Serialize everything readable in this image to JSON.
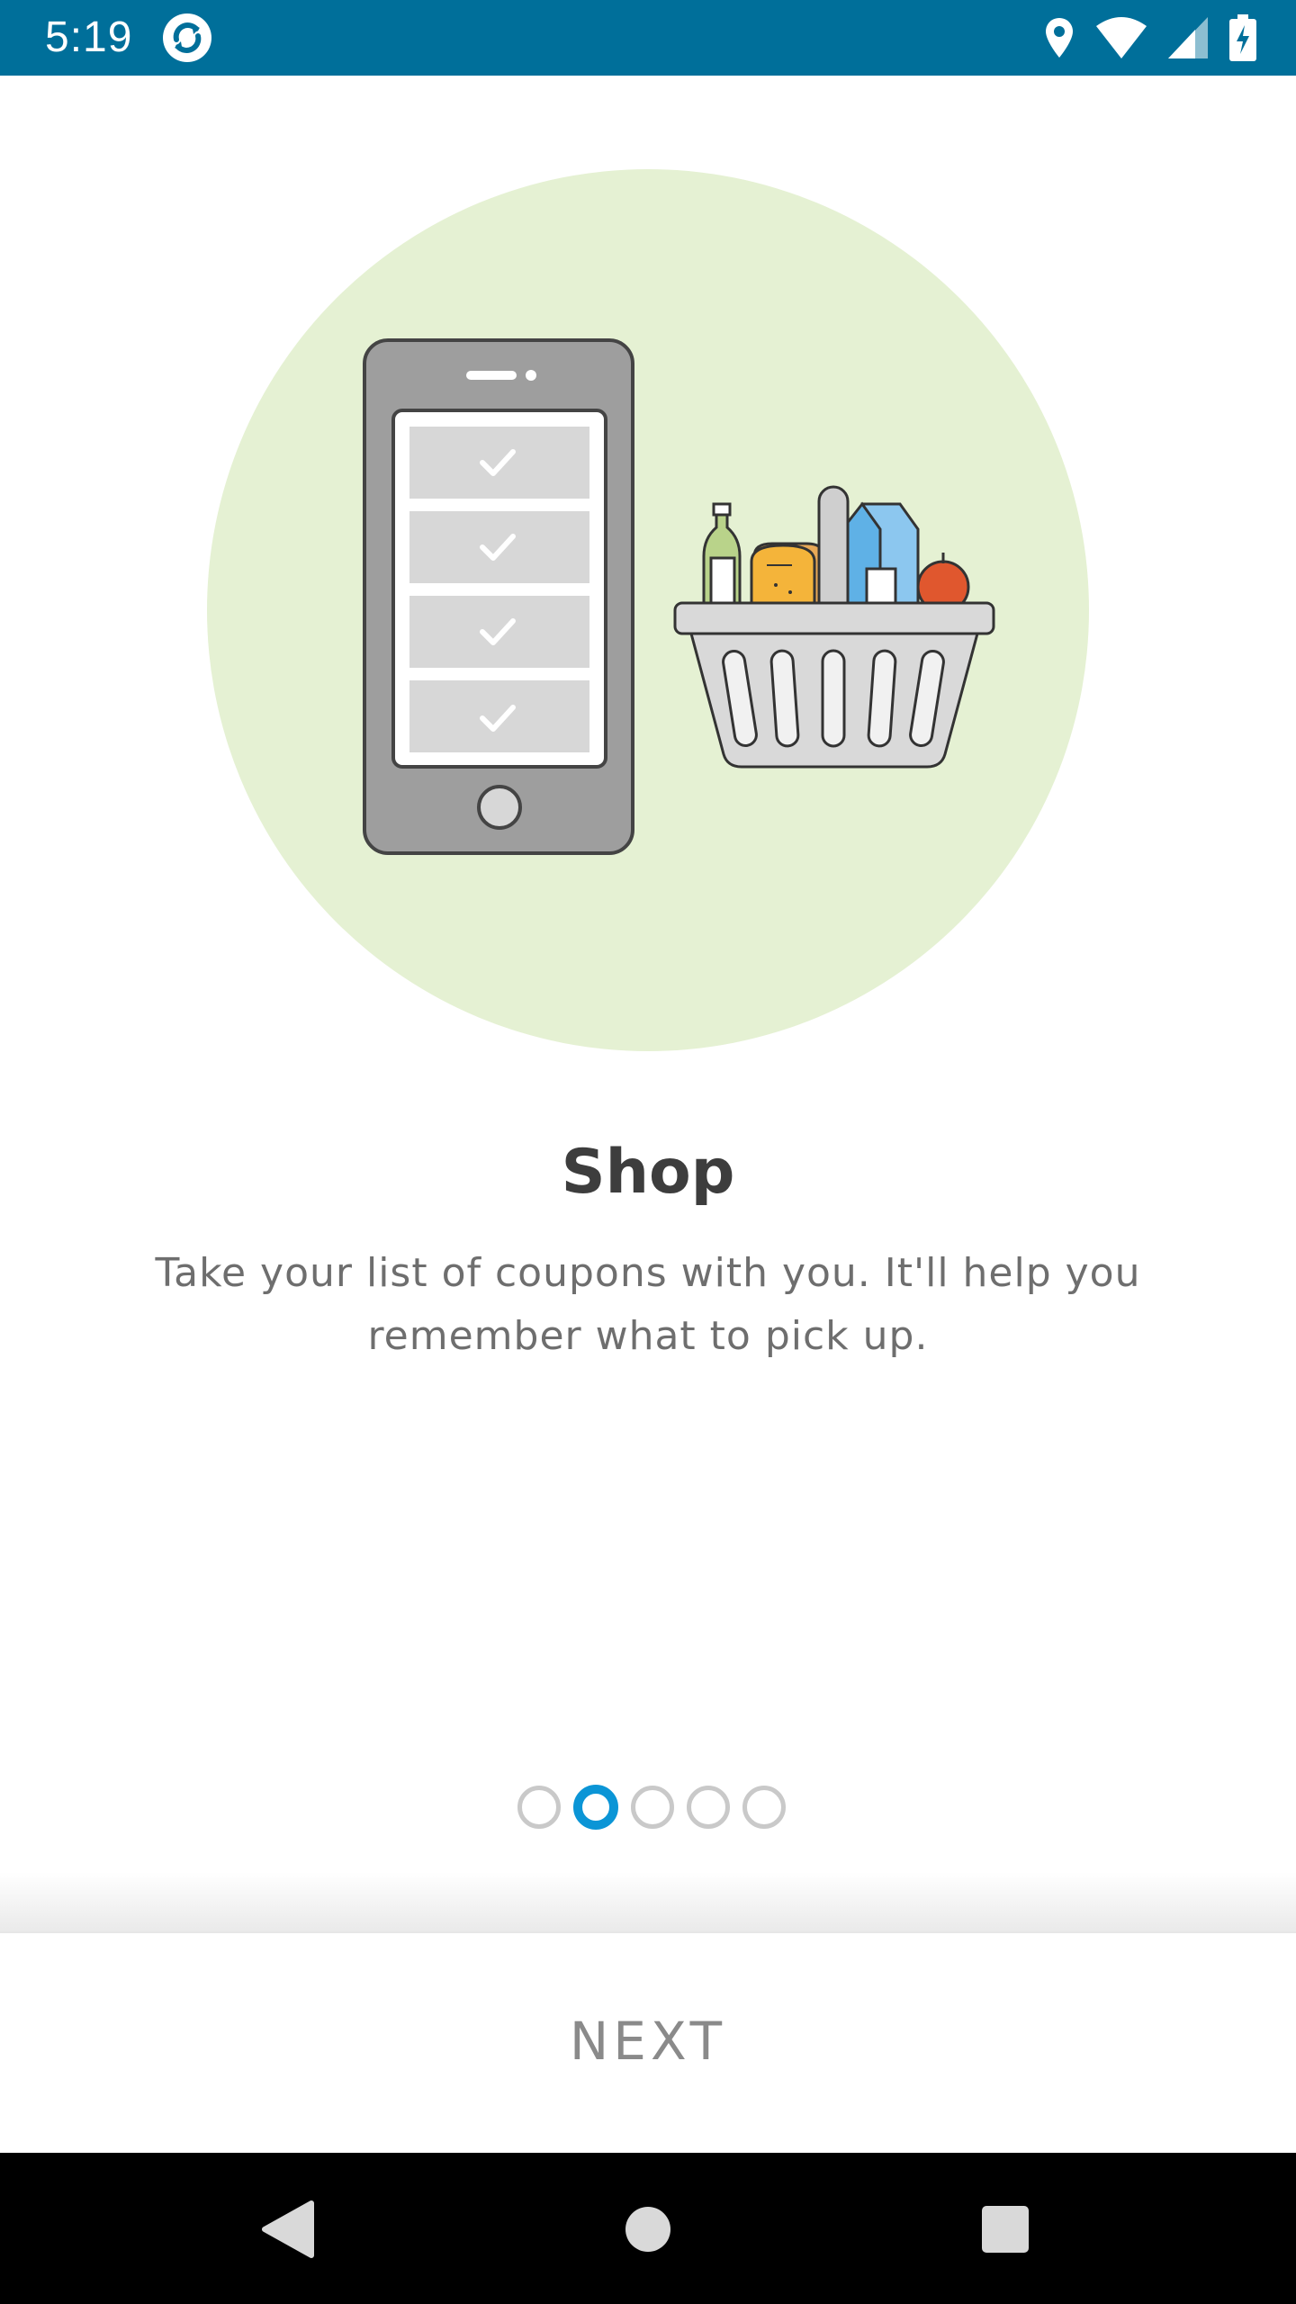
{
  "status_bar": {
    "time": "5:19",
    "app_icon": "refresh-app-icon",
    "icons": [
      "location-icon",
      "wifi-icon",
      "cell-signal-icon",
      "battery-charging-icon"
    ],
    "background_color": "#006f9a"
  },
  "illustration": {
    "description_icons": [
      "phone-checklist-icon",
      "grocery-basket-icon"
    ],
    "circle_color": "#e5f1d3"
  },
  "onboarding": {
    "title": "Shop",
    "description": "Take your list of coupons with you. It'll help you remember what to pick up."
  },
  "pager": {
    "total_pages": 5,
    "active_page": 2,
    "active_color": "#0b95d6"
  },
  "actions": {
    "next_label": "NEXT"
  },
  "nav_bar": {
    "buttons": [
      "back-icon",
      "home-icon",
      "recents-icon"
    ]
  }
}
